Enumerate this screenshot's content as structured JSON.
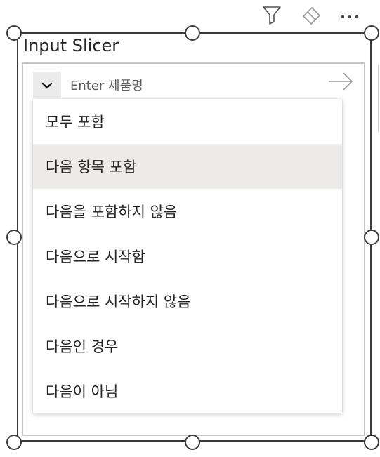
{
  "visual": {
    "title": "Input Slicer"
  },
  "toolbar": {
    "filter_icon": "filter-icon",
    "eraser_icon": "eraser-icon",
    "more_icon": "more-options-icon"
  },
  "input": {
    "placeholder": "Enter 제품명",
    "chevron_icon": "chevron-down-icon",
    "submit_icon": "arrow-right-icon"
  },
  "dropdown": {
    "items": [
      {
        "label": "모두 포함"
      },
      {
        "label": "다음 항목 포함"
      },
      {
        "label": "다음을 포함하지 않음"
      },
      {
        "label": "다음으로 시작함"
      },
      {
        "label": "다음으로 시작하지 않음"
      },
      {
        "label": "다음인 경우"
      },
      {
        "label": "다음이 아님"
      }
    ],
    "hovered_index": 1
  },
  "colors": {
    "frame_border": "#3b3b3b",
    "inner_border": "#c8c6c4",
    "hover_bg": "#edebe9",
    "text": "#252423",
    "muted_text": "#605e5c"
  }
}
